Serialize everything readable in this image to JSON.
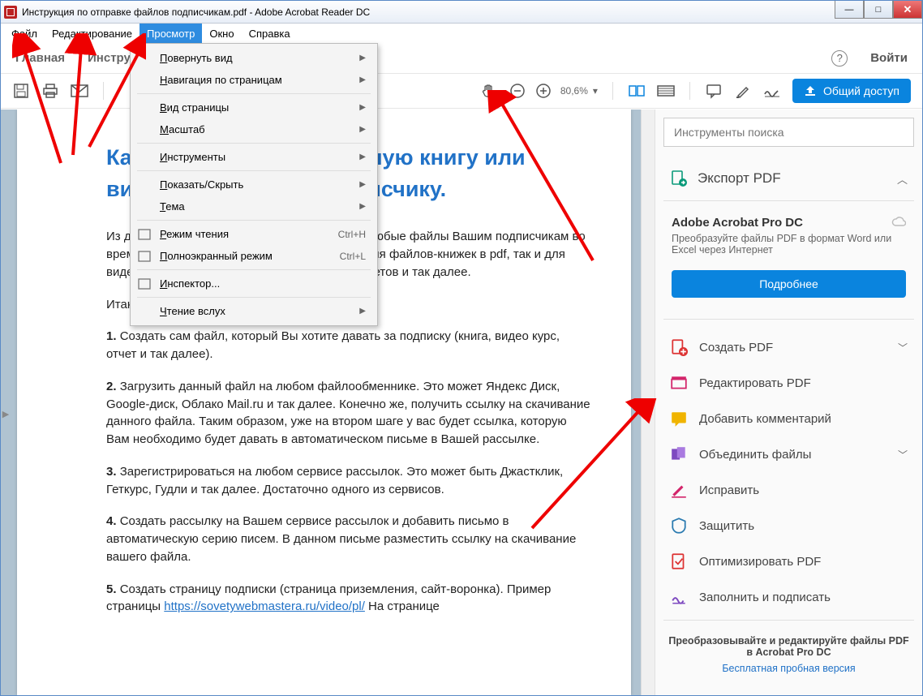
{
  "window": {
    "title": "Инструкция по отправке файлов подписчикам.pdf - Adobe Acrobat Reader DC",
    "min": "—",
    "max": "□",
    "close": "✕"
  },
  "menubar": [
    "Файл",
    "Редактирование",
    "Просмотр",
    "Окно",
    "Справка"
  ],
  "tabs": {
    "home": "Главная",
    "tools": "Инструменты",
    "login": "Войти"
  },
  "toolbar": {
    "zoom": "80,6%",
    "share": "Общий доступ"
  },
  "dropdown": {
    "items": [
      {
        "label": "Повернуть вид",
        "arrow": true
      },
      {
        "label": "Навигация по страницам",
        "arrow": true
      },
      {
        "sep": true
      },
      {
        "label": "Вид страницы",
        "arrow": true
      },
      {
        "label": "Масштаб",
        "arrow": true
      },
      {
        "sep": true
      },
      {
        "label": "Инструменты",
        "arrow": true
      },
      {
        "sep": true
      },
      {
        "label": "Показать/Скрыть",
        "arrow": true
      },
      {
        "label": "Тема",
        "arrow": true
      },
      {
        "sep": true
      },
      {
        "label": "Режим чтения",
        "sc": "Ctrl+H",
        "icon": "read"
      },
      {
        "label": "Полноэкранный режим",
        "sc": "Ctrl+L",
        "icon": "full"
      },
      {
        "sep": true
      },
      {
        "label": "Инспектор...",
        "icon": "inspect"
      },
      {
        "sep": true
      },
      {
        "label": "Чтение вслух",
        "arrow": true
      }
    ]
  },
  "document": {
    "title1": "Как отправлять бесплатную книгу или видеокурс новому подписчику.",
    "p1": "Из данной статьи Вы узнаете, как отправлять любые файлы Вашим подписчикам во время подписки. То есть, схема подходит как для файлов-книжек в pdf, так и для видео курсов, для аудио курсов, любых pdf-отчетов и так далее.",
    "p2": "Итак, давайте все разберем по шагам.",
    "p3a": "1. ",
    "p3b": "Создать сам файл, который Вы хотите давать за подписку (книга, видео курс, отчет и так далее).",
    "p4a": "2. ",
    "p4b": "Загрузить данный файл на любом файлообменнике. Это может Яндекс Диск, Google-диск, Облако Mail.ru и так далее. Конечно же, получить ссылку на скачивание данного файла. Таким образом, уже на втором шаге у вас будет ссылка, которую Вам необходимо будет давать в автоматическом письме в Вашей рассылке.",
    "p5a": "3. ",
    "p5b": "Зарегистрироваться на любом сервисе рассылок. Это может быть Джастклик, Геткурс, Гудли и так далее. Достаточно одного из сервисов.",
    "p6a": "4. ",
    "p6b": "Создать рассылку на Вашем сервисе рассылок и добавить письмо в автоматическую серию писем. В данном письме разместить ссылку на скачивание вашего файла.",
    "p7a": "5. ",
    "p7b": "Создать страницу подписки (страница приземления, сайт-воронка). Пример страницы ",
    "p7link": "https://sovetywebmastera.ru/video/pl/",
    "p7c": " На странице"
  },
  "side": {
    "search": "Инструменты поиска",
    "export": {
      "title": "Экспорт PDF",
      "prod": "Adobe Acrobat Pro DC",
      "desc": "Преобразуйте файлы PDF в формат Word или Excel через Интернет",
      "btn": "Подробнее"
    },
    "tools": [
      {
        "label": "Создать PDF",
        "exp": true,
        "color": "red",
        "icon": "create"
      },
      {
        "label": "Редактировать PDF",
        "color": "pink",
        "icon": "edit"
      },
      {
        "label": "Добавить комментарий",
        "color": "yellow",
        "icon": "comment"
      },
      {
        "label": "Объединить файлы",
        "exp": true,
        "color": "purple",
        "icon": "combine"
      },
      {
        "label": "Исправить",
        "color": "pink",
        "icon": "redact"
      },
      {
        "label": "Защитить",
        "color": "blue",
        "icon": "protect"
      },
      {
        "label": "Оптимизировать PDF",
        "color": "red",
        "icon": "optimize"
      },
      {
        "label": "Заполнить и подписать",
        "color": "purple",
        "icon": "sign"
      }
    ],
    "promo": {
      "t": "Преобразовывайте и редактируйте файлы PDF в Acrobat Pro DC",
      "l": "Бесплатная пробная версия"
    }
  }
}
